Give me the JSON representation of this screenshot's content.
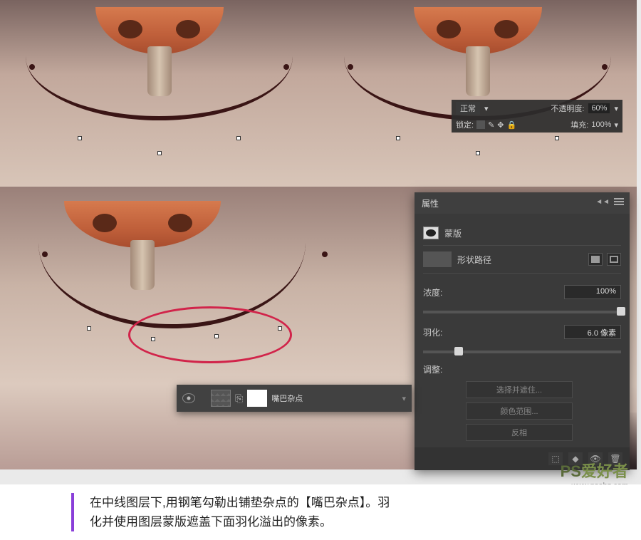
{
  "blendPanel": {
    "mode": "正常",
    "opacityLabel": "不透明度:",
    "opacityValue": "60%",
    "lockLabel": "锁定:",
    "fillLabel": "填充:",
    "fillValue": "100%"
  },
  "properties": {
    "title": "属性",
    "maskLabel": "蒙版",
    "shapePathLabel": "形状路径",
    "density": {
      "label": "浓度:",
      "value": "100%",
      "pos": 100
    },
    "feather": {
      "label": "羽化:",
      "value": "6.0 像素",
      "pos": 18
    },
    "adjustLabel": "调整:",
    "buttons": {
      "selectAndMask": "选择并遮住...",
      "colorRange": "颜色范围...",
      "invert": "反相"
    }
  },
  "layerStrip": {
    "name": "嘴巴杂点"
  },
  "caption": {
    "line1": "在中线图层下,用钢笔勾勒出铺垫杂点的【嘴巴杂点】。羽",
    "line2": "化并使用图层蒙版遮盖下面羽化溢出的像素。"
  },
  "watermark": {
    "brand_ps": "PS",
    "brand_cn": "爱好者",
    "url": "www.psahz.com"
  }
}
